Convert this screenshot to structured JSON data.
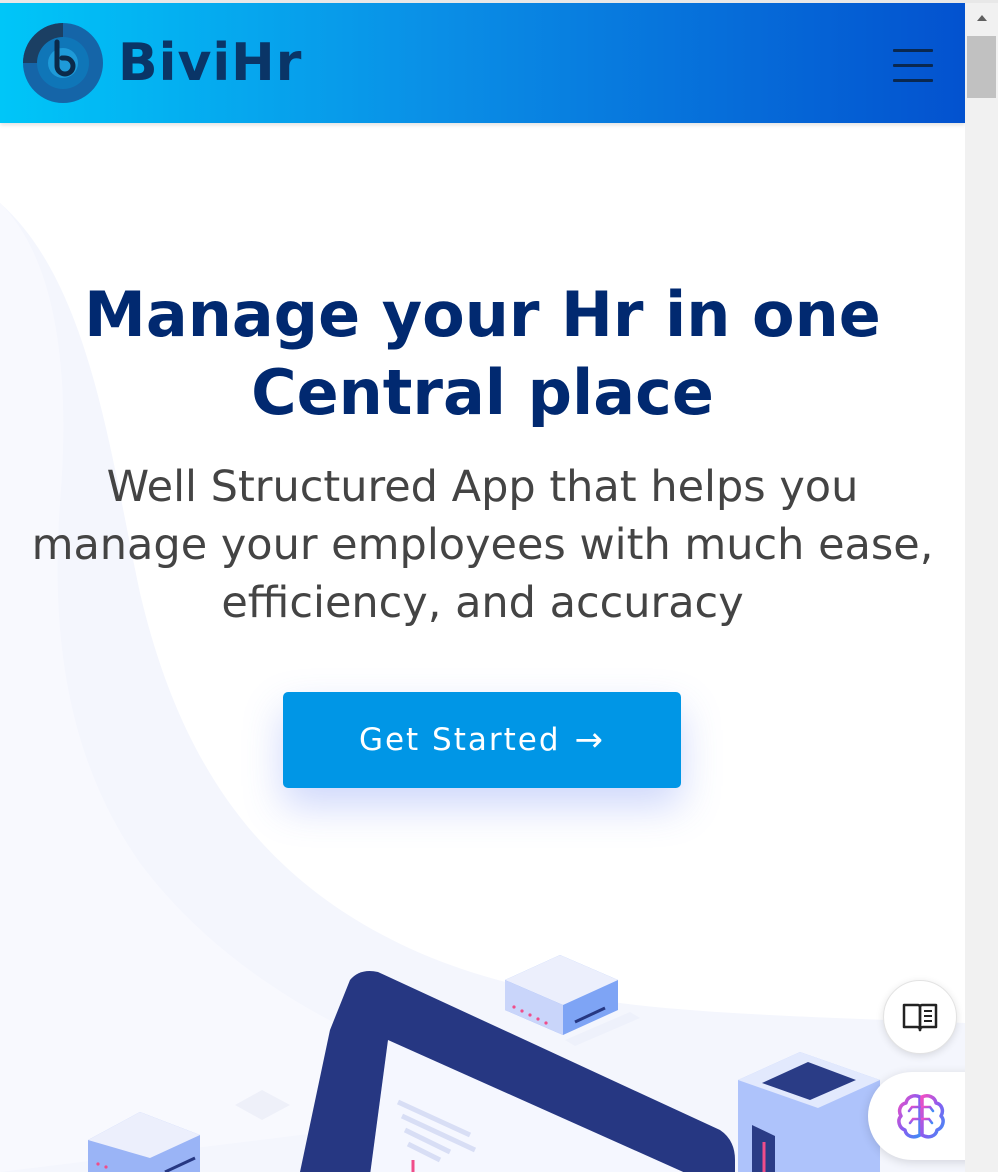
{
  "header": {
    "brand": "BiviHr",
    "brand_color": "#0a3567",
    "gradient_start": "#00c6f8",
    "gradient_end": "#0352cf",
    "menu_icon": "hamburger-icon"
  },
  "hero": {
    "title": "Manage your Hr in one Central place",
    "subtitle": "Well Structured App that helps you manage your employees with much ease, efficiency, and accuracy",
    "cta_label": "Get Started",
    "cta_icon": "arrow-right-icon",
    "title_color": "#012970",
    "cta_color": "#0096e6"
  },
  "floating": {
    "reader_icon": "book-open-icon",
    "assistant_icon": "brain-icon"
  }
}
